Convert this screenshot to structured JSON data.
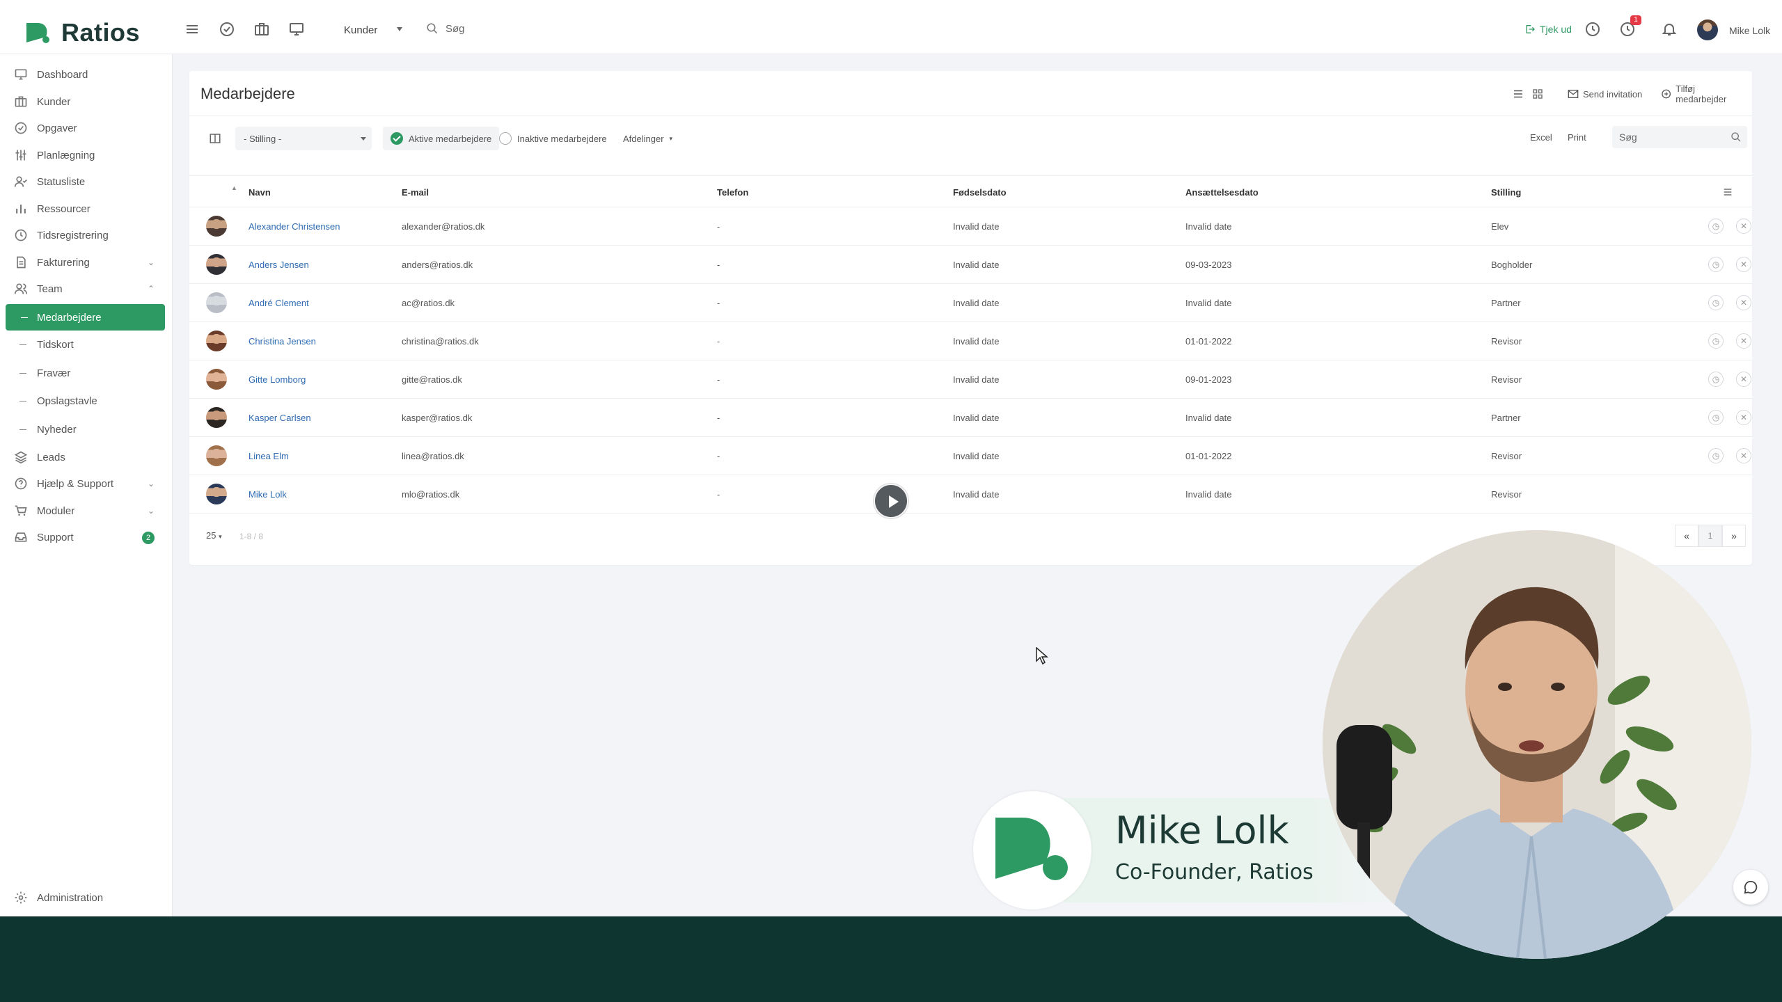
{
  "brand": {
    "name": "Ratios",
    "accent": "#2e9a63",
    "dark": "#0f3530"
  },
  "topbar": {
    "icons": [
      "menu-icon",
      "check-circle-icon",
      "briefcase-icon",
      "monitor-icon"
    ],
    "client_select": "Kunder",
    "search_label": "Søg",
    "checkout_label": "Tjek ud",
    "notif_badge": "1",
    "user_name": "Mike Lolk"
  },
  "sidebar": {
    "items": [
      {
        "label": "Dashboard",
        "icon": "monitor-icon"
      },
      {
        "label": "Kunder",
        "icon": "briefcase-icon"
      },
      {
        "label": "Opgaver",
        "icon": "check-circle-icon"
      },
      {
        "label": "Planlægning",
        "icon": "sliders-icon"
      },
      {
        "label": "Statusliste",
        "icon": "user-check-icon"
      },
      {
        "label": "Ressourcer",
        "icon": "bar-chart-icon"
      },
      {
        "label": "Tidsregistrering",
        "icon": "clock-icon"
      },
      {
        "label": "Fakturering",
        "icon": "document-icon"
      },
      {
        "label": "Team",
        "icon": "users-icon"
      }
    ],
    "team_sub": [
      "Medarbejdere",
      "Tidskort",
      "Fravær",
      "Opslagstavle",
      "Nyheder"
    ],
    "lower_items": [
      {
        "label": "Leads",
        "icon": "layers-icon"
      },
      {
        "label": "Hjælp & Support",
        "icon": "help-circle-icon"
      },
      {
        "label": "Moduler",
        "icon": "cart-icon"
      },
      {
        "label": "Support",
        "icon": "inbox-icon"
      }
    ],
    "support_badge": "2",
    "admin_label": "Administration"
  },
  "page": {
    "title": "Medarbejdere",
    "send_invitation": "Send invitation",
    "add_employee": "Tilføj medarbejder",
    "filters": {
      "position_select": "- Stilling -",
      "active_label": "Aktive medarbejdere",
      "inactive_label": "Inaktive medarbejdere",
      "departments_label": "Afdelinger",
      "excel": "Excel",
      "print": "Print",
      "search_placeholder": "Søg"
    },
    "columns": [
      "Navn",
      "E-mail",
      "Telefon",
      "Fødselsdato",
      "Ansættelsesdato",
      "Stilling"
    ],
    "rows": [
      {
        "name": "Alexander Christensen",
        "email": "alexander@ratios.dk",
        "phone": "-",
        "birth": "Invalid date",
        "hired": "Invalid date",
        "position": "Elev"
      },
      {
        "name": "Anders Jensen",
        "email": "anders@ratios.dk",
        "phone": "-",
        "birth": "Invalid date",
        "hired": "09-03-2023",
        "position": "Bogholder"
      },
      {
        "name": "André Clement",
        "email": "ac@ratios.dk",
        "phone": "-",
        "birth": "Invalid date",
        "hired": "Invalid date",
        "position": "Partner"
      },
      {
        "name": "Christina Jensen",
        "email": "christina@ratios.dk",
        "phone": "-",
        "birth": "Invalid date",
        "hired": "01-01-2022",
        "position": "Revisor"
      },
      {
        "name": "Gitte Lomborg",
        "email": "gitte@ratios.dk",
        "phone": "-",
        "birth": "Invalid date",
        "hired": "09-01-2023",
        "position": "Revisor"
      },
      {
        "name": "Kasper Carlsen",
        "email": "kasper@ratios.dk",
        "phone": "-",
        "birth": "Invalid date",
        "hired": "Invalid date",
        "position": "Partner"
      },
      {
        "name": "Linea Elm",
        "email": "linea@ratios.dk",
        "phone": "-",
        "birth": "Invalid date",
        "hired": "01-01-2022",
        "position": "Revisor"
      },
      {
        "name": "Mike Lolk",
        "email": "mlo@ratios.dk",
        "phone": "-",
        "birth": "Invalid date",
        "hired": "Invalid date",
        "position": "Revisor"
      }
    ],
    "pager": {
      "page_size": "25",
      "count": "1-8 / 8",
      "prev": "«",
      "current": "1",
      "next": "»"
    }
  },
  "overlay": {
    "name": "Mike Lolk",
    "role": "Co-Founder, Ratios"
  }
}
